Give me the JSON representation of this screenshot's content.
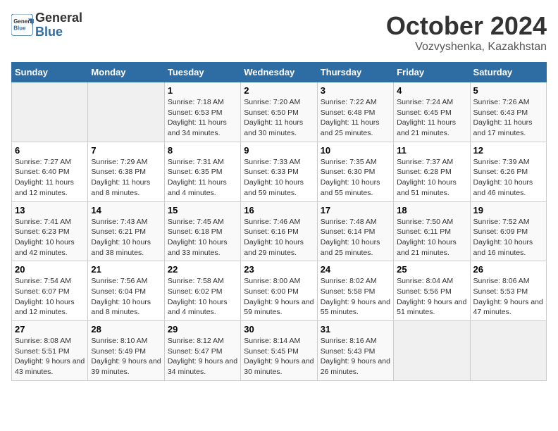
{
  "header": {
    "logo_line1": "General",
    "logo_line2": "Blue",
    "month": "October 2024",
    "location": "Vozvyshenka, Kazakhstan"
  },
  "days_of_week": [
    "Sunday",
    "Monday",
    "Tuesday",
    "Wednesday",
    "Thursday",
    "Friday",
    "Saturday"
  ],
  "weeks": [
    [
      {
        "day": "",
        "info": ""
      },
      {
        "day": "",
        "info": ""
      },
      {
        "day": "1",
        "sunrise": "Sunrise: 7:18 AM",
        "sunset": "Sunset: 6:53 PM",
        "daylight": "Daylight: 11 hours and 34 minutes."
      },
      {
        "day": "2",
        "sunrise": "Sunrise: 7:20 AM",
        "sunset": "Sunset: 6:50 PM",
        "daylight": "Daylight: 11 hours and 30 minutes."
      },
      {
        "day": "3",
        "sunrise": "Sunrise: 7:22 AM",
        "sunset": "Sunset: 6:48 PM",
        "daylight": "Daylight: 11 hours and 25 minutes."
      },
      {
        "day": "4",
        "sunrise": "Sunrise: 7:24 AM",
        "sunset": "Sunset: 6:45 PM",
        "daylight": "Daylight: 11 hours and 21 minutes."
      },
      {
        "day": "5",
        "sunrise": "Sunrise: 7:26 AM",
        "sunset": "Sunset: 6:43 PM",
        "daylight": "Daylight: 11 hours and 17 minutes."
      }
    ],
    [
      {
        "day": "6",
        "sunrise": "Sunrise: 7:27 AM",
        "sunset": "Sunset: 6:40 PM",
        "daylight": "Daylight: 11 hours and 12 minutes."
      },
      {
        "day": "7",
        "sunrise": "Sunrise: 7:29 AM",
        "sunset": "Sunset: 6:38 PM",
        "daylight": "Daylight: 11 hours and 8 minutes."
      },
      {
        "day": "8",
        "sunrise": "Sunrise: 7:31 AM",
        "sunset": "Sunset: 6:35 PM",
        "daylight": "Daylight: 11 hours and 4 minutes."
      },
      {
        "day": "9",
        "sunrise": "Sunrise: 7:33 AM",
        "sunset": "Sunset: 6:33 PM",
        "daylight": "Daylight: 10 hours and 59 minutes."
      },
      {
        "day": "10",
        "sunrise": "Sunrise: 7:35 AM",
        "sunset": "Sunset: 6:30 PM",
        "daylight": "Daylight: 10 hours and 55 minutes."
      },
      {
        "day": "11",
        "sunrise": "Sunrise: 7:37 AM",
        "sunset": "Sunset: 6:28 PM",
        "daylight": "Daylight: 10 hours and 51 minutes."
      },
      {
        "day": "12",
        "sunrise": "Sunrise: 7:39 AM",
        "sunset": "Sunset: 6:26 PM",
        "daylight": "Daylight: 10 hours and 46 minutes."
      }
    ],
    [
      {
        "day": "13",
        "sunrise": "Sunrise: 7:41 AM",
        "sunset": "Sunset: 6:23 PM",
        "daylight": "Daylight: 10 hours and 42 minutes."
      },
      {
        "day": "14",
        "sunrise": "Sunrise: 7:43 AM",
        "sunset": "Sunset: 6:21 PM",
        "daylight": "Daylight: 10 hours and 38 minutes."
      },
      {
        "day": "15",
        "sunrise": "Sunrise: 7:45 AM",
        "sunset": "Sunset: 6:18 PM",
        "daylight": "Daylight: 10 hours and 33 minutes."
      },
      {
        "day": "16",
        "sunrise": "Sunrise: 7:46 AM",
        "sunset": "Sunset: 6:16 PM",
        "daylight": "Daylight: 10 hours and 29 minutes."
      },
      {
        "day": "17",
        "sunrise": "Sunrise: 7:48 AM",
        "sunset": "Sunset: 6:14 PM",
        "daylight": "Daylight: 10 hours and 25 minutes."
      },
      {
        "day": "18",
        "sunrise": "Sunrise: 7:50 AM",
        "sunset": "Sunset: 6:11 PM",
        "daylight": "Daylight: 10 hours and 21 minutes."
      },
      {
        "day": "19",
        "sunrise": "Sunrise: 7:52 AM",
        "sunset": "Sunset: 6:09 PM",
        "daylight": "Daylight: 10 hours and 16 minutes."
      }
    ],
    [
      {
        "day": "20",
        "sunrise": "Sunrise: 7:54 AM",
        "sunset": "Sunset: 6:07 PM",
        "daylight": "Daylight: 10 hours and 12 minutes."
      },
      {
        "day": "21",
        "sunrise": "Sunrise: 7:56 AM",
        "sunset": "Sunset: 6:04 PM",
        "daylight": "Daylight: 10 hours and 8 minutes."
      },
      {
        "day": "22",
        "sunrise": "Sunrise: 7:58 AM",
        "sunset": "Sunset: 6:02 PM",
        "daylight": "Daylight: 10 hours and 4 minutes."
      },
      {
        "day": "23",
        "sunrise": "Sunrise: 8:00 AM",
        "sunset": "Sunset: 6:00 PM",
        "daylight": "Daylight: 9 hours and 59 minutes."
      },
      {
        "day": "24",
        "sunrise": "Sunrise: 8:02 AM",
        "sunset": "Sunset: 5:58 PM",
        "daylight": "Daylight: 9 hours and 55 minutes."
      },
      {
        "day": "25",
        "sunrise": "Sunrise: 8:04 AM",
        "sunset": "Sunset: 5:56 PM",
        "daylight": "Daylight: 9 hours and 51 minutes."
      },
      {
        "day": "26",
        "sunrise": "Sunrise: 8:06 AM",
        "sunset": "Sunset: 5:53 PM",
        "daylight": "Daylight: 9 hours and 47 minutes."
      }
    ],
    [
      {
        "day": "27",
        "sunrise": "Sunrise: 8:08 AM",
        "sunset": "Sunset: 5:51 PM",
        "daylight": "Daylight: 9 hours and 43 minutes."
      },
      {
        "day": "28",
        "sunrise": "Sunrise: 8:10 AM",
        "sunset": "Sunset: 5:49 PM",
        "daylight": "Daylight: 9 hours and 39 minutes."
      },
      {
        "day": "29",
        "sunrise": "Sunrise: 8:12 AM",
        "sunset": "Sunset: 5:47 PM",
        "daylight": "Daylight: 9 hours and 34 minutes."
      },
      {
        "day": "30",
        "sunrise": "Sunrise: 8:14 AM",
        "sunset": "Sunset: 5:45 PM",
        "daylight": "Daylight: 9 hours and 30 minutes."
      },
      {
        "day": "31",
        "sunrise": "Sunrise: 8:16 AM",
        "sunset": "Sunset: 5:43 PM",
        "daylight": "Daylight: 9 hours and 26 minutes."
      },
      {
        "day": "",
        "info": ""
      },
      {
        "day": "",
        "info": ""
      }
    ]
  ]
}
